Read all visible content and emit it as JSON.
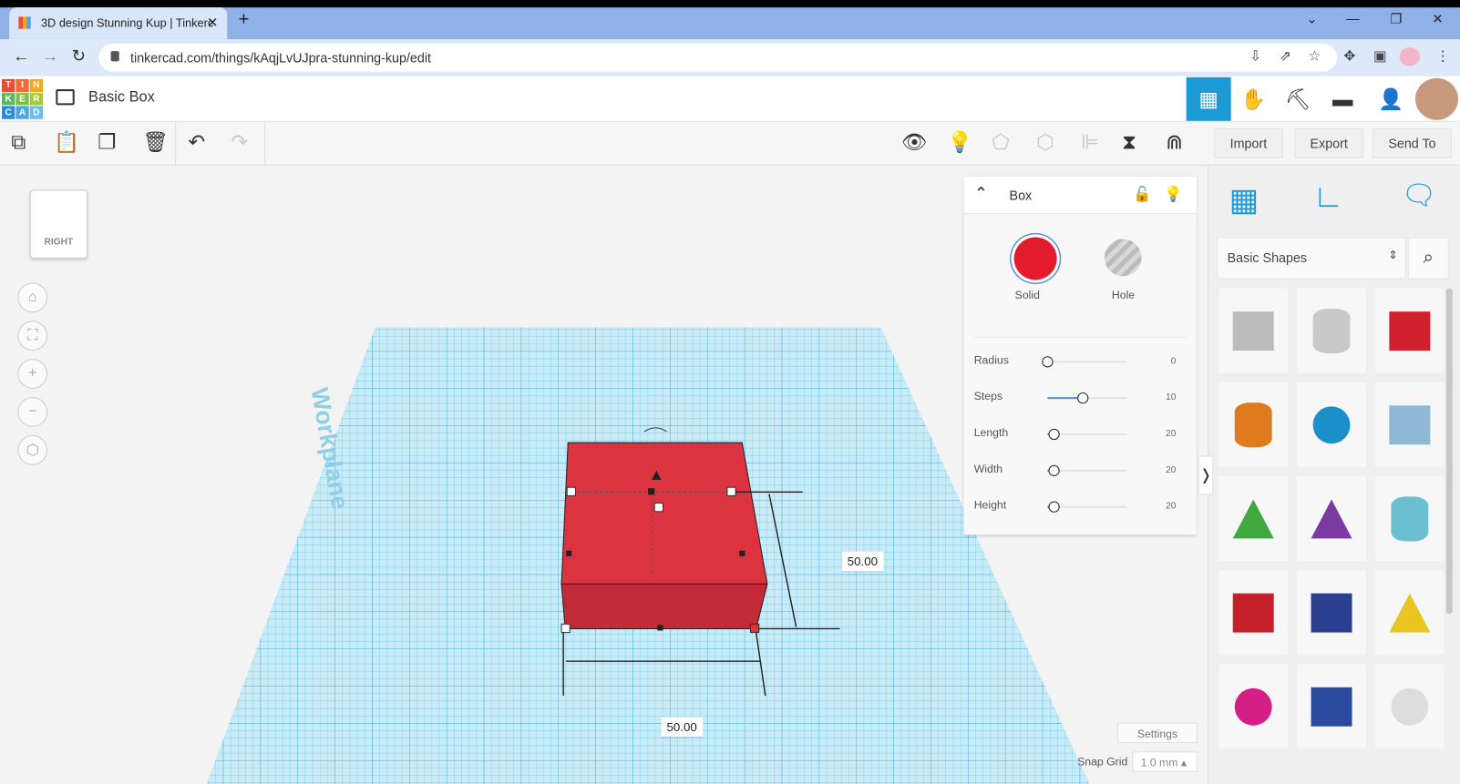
{
  "browser": {
    "tab_title": "3D design Stunning Kup | Tinkerc",
    "new_tab": "+",
    "close": "✕",
    "url": "tinkercad.com/things/kAqjLvUJpra-stunning-kup/edit"
  },
  "app": {
    "logo": [
      "T",
      "I",
      "N",
      "K",
      "E",
      "R",
      "C",
      "A",
      "D"
    ],
    "design_title": "Basic Box"
  },
  "toolbar": {
    "import": "Import",
    "export": "Export",
    "send_to": "Send To"
  },
  "viewcube": {
    "face": "RIGHT"
  },
  "workplane": {
    "label": "Workplane"
  },
  "dimensions": {
    "width": "50.00",
    "length": "50.00"
  },
  "inspector": {
    "title": "Box",
    "solid": "Solid",
    "hole": "Hole",
    "params": [
      {
        "label": "Radius",
        "value": "0",
        "fraction": 0
      },
      {
        "label": "Steps",
        "value": "10",
        "fraction": 0.45
      },
      {
        "label": "Length",
        "value": "20",
        "fraction": 0.08
      },
      {
        "label": "Width",
        "value": "20",
        "fraction": 0.08
      },
      {
        "label": "Height",
        "value": "20",
        "fraction": 0.08
      }
    ]
  },
  "library": {
    "category": "Basic Shapes"
  },
  "footer": {
    "settings": "Settings",
    "snap_grid_label": "Snap Grid",
    "snap_grid_value": "1.0 mm ▴"
  },
  "colors": {
    "accent": "#1b9ad6",
    "solid": "#e21b2e",
    "box": "#dc3340",
    "workplane": "#a7dcef"
  }
}
